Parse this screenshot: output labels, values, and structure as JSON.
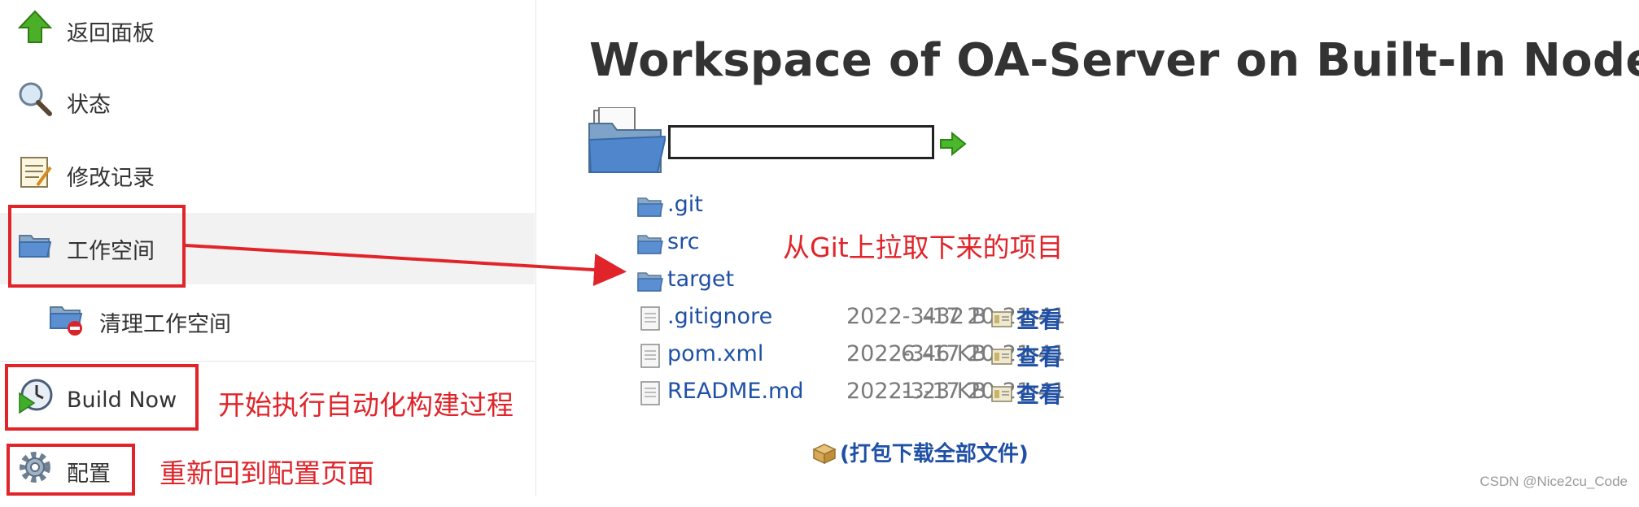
{
  "sidebar": {
    "items": [
      {
        "label": "返回面板",
        "icon": "up-arrow-icon"
      },
      {
        "label": "状态",
        "icon": "magnifier-icon"
      },
      {
        "label": "修改记录",
        "icon": "notepad-icon"
      },
      {
        "label": "工作空间",
        "icon": "folder-icon"
      },
      {
        "label": "清理工作空间",
        "icon": "folder-delete-icon"
      },
      {
        "label": "Build Now",
        "icon": "clock-play-icon"
      },
      {
        "label": "配置",
        "icon": "gear-icon"
      }
    ]
  },
  "main": {
    "title": "Workspace of OA-Server on Built-In Node",
    "path_input_value": "",
    "files": [
      {
        "name": ".git",
        "type": "folder"
      },
      {
        "name": "src",
        "type": "folder"
      },
      {
        "name": "target",
        "type": "folder"
      },
      {
        "name": ".gitignore",
        "type": "file",
        "date": "2022-3-17 20:21:41",
        "size": "432 B",
        "view": "查看"
      },
      {
        "name": "pom.xml",
        "type": "file",
        "date": "2022-3-17 20:21:41",
        "size": "6.46 KB",
        "view": "查看"
      },
      {
        "name": "README.md",
        "type": "file",
        "date": "2022-3-17 20:21:41",
        "size": "1.23 KB",
        "view": "查看"
      }
    ],
    "download_label": "(打包下载全部文件)"
  },
  "annotations": {
    "workspace_note": "从Git上拉取下来的项目",
    "build_note": "开始执行自动化构建过程",
    "config_note": "重新回到配置页面"
  },
  "watermark": "CSDN @Nice2cu_Code",
  "colors": {
    "link": "#1f50a6",
    "annotation": "#e0242a",
    "active_bg": "#f2f2f2"
  }
}
